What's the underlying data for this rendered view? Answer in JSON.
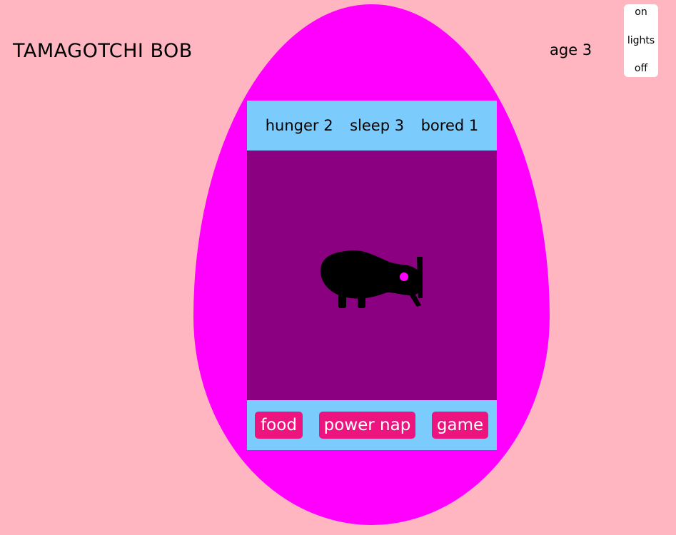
{
  "app": {
    "title": "TAMAGOTCHI BOB",
    "age_text": "age 3"
  },
  "lights": {
    "on_label": "on",
    "label": "lights",
    "off_label": "off"
  },
  "stats": {
    "hunger": "hunger 2",
    "sleep": "sleep 3",
    "bored": "bored 1"
  },
  "pet": {
    "icon": "kiwi-bird-icon"
  },
  "actions": {
    "food": "food",
    "power_nap": "power nap",
    "game": "game"
  },
  "colors": {
    "background": "#ffb6c1",
    "egg": "#ff00ff",
    "screen": "#8b0080",
    "bars": "#7bcbfd",
    "buttons": "#ee1480"
  }
}
